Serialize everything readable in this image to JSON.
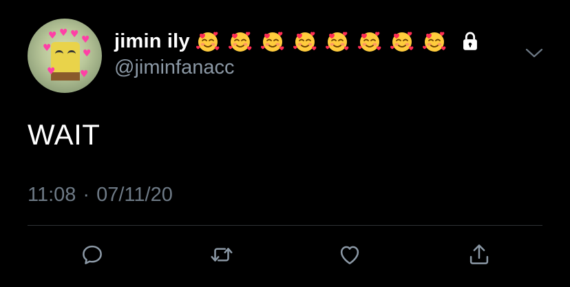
{
  "user": {
    "display_name": "jimin ily",
    "emoji_count": 8,
    "emoji": "smiling-face-with-hearts-icon",
    "protected_icon": "lock-icon",
    "handle": "@jiminfanacc"
  },
  "tweet": {
    "text": "WAIT",
    "time": "11:08",
    "separator": "·",
    "date": "07/11/20"
  },
  "actions": [
    "reply-icon",
    "retweet-icon",
    "like-icon",
    "share-icon"
  ],
  "colors": {
    "background": "#000000",
    "primary_text": "#ffffff",
    "secondary_text": "#8b98a5",
    "divider": "#2f3336"
  }
}
